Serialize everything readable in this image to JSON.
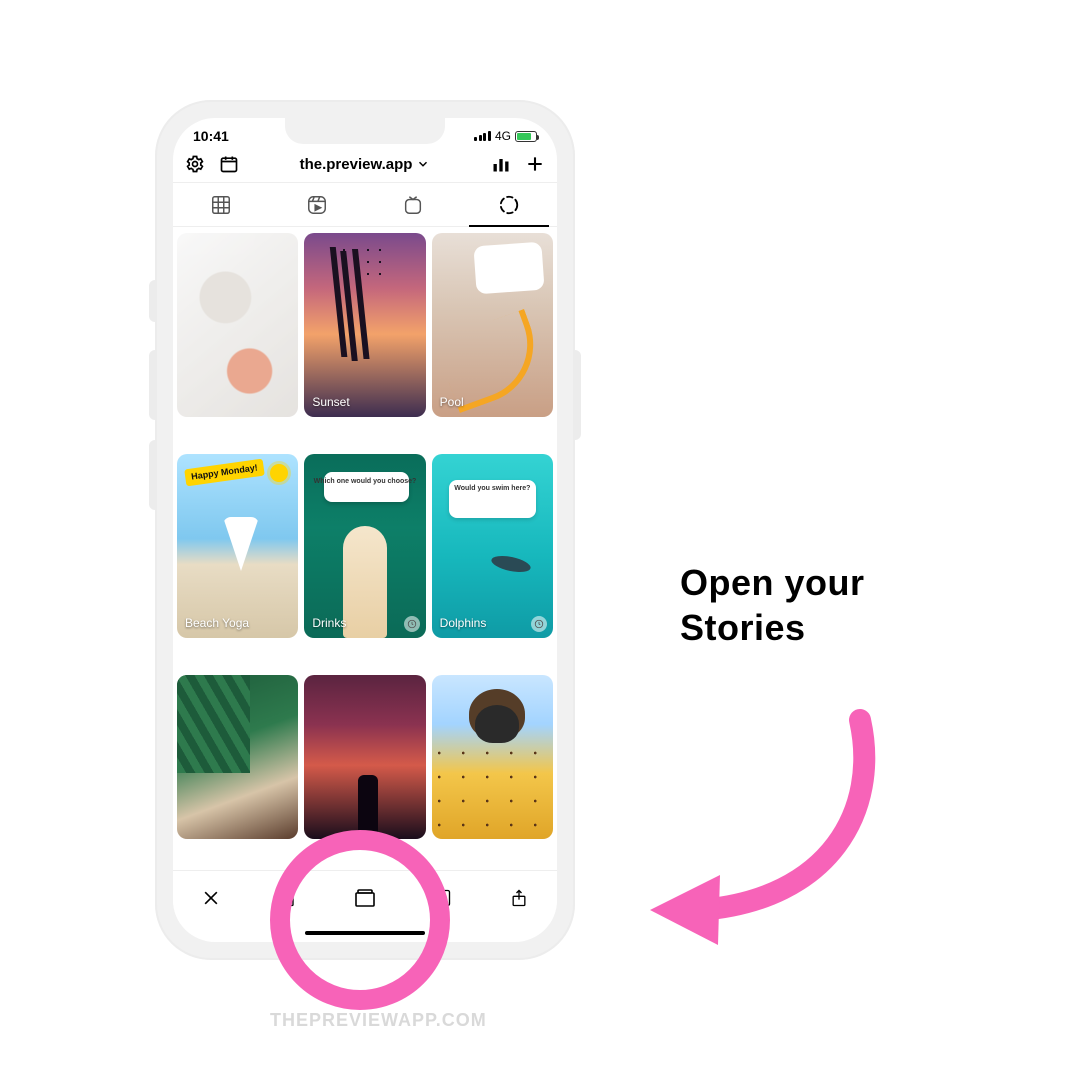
{
  "status_bar": {
    "time": "10:41",
    "network_label": "4G"
  },
  "header": {
    "username": "the.preview.app"
  },
  "stories": [
    {
      "label": ""
    },
    {
      "label": "Sunset"
    },
    {
      "label": "Pool"
    },
    {
      "label": "Beach Yoga",
      "badge_text": "Happy Monday!"
    },
    {
      "label": "Drinks",
      "poll_text": "Which one would you choose?",
      "scheduled": true
    },
    {
      "label": "Dolphins",
      "poll_text": "Would you swim here?",
      "scheduled": true
    },
    {
      "label": ""
    },
    {
      "label": ""
    },
    {
      "label": ""
    }
  ],
  "annotation": {
    "caption_line1": "Open your",
    "caption_line2": "Stories",
    "highlight_color": "#f763b8"
  },
  "watermark": "THEPREVIEWAPP.COM"
}
